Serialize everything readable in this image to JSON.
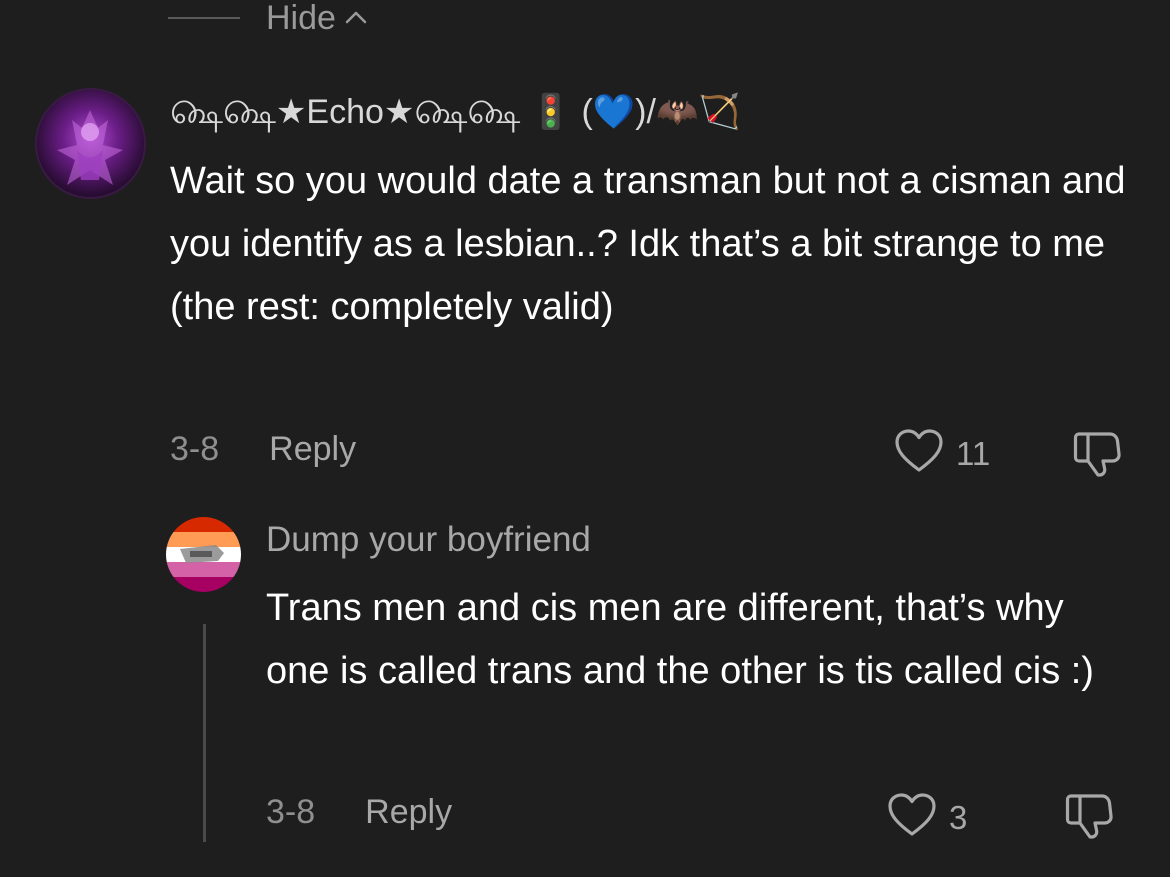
{
  "hide_toggle": {
    "label": "Hide"
  },
  "comments": [
    {
      "username": "௸௸★Echo★௸௸ 🚦 (💙)/🦇🏹",
      "text": "Wait so you would date a transman but not a cisman and you identify as a lesbian..? Idk that’s a bit strange to me (the rest: completely valid)",
      "date": "3-8",
      "reply_label": "Reply",
      "likes": "11"
    },
    {
      "username": "Dump your boyfriend",
      "text": "Trans men and cis men are different, that’s why one is called trans and the other is tis called cis :)",
      "date": "3-8",
      "reply_label": "Reply",
      "likes": "3"
    }
  ],
  "colors": {
    "background": "#1e1e1e",
    "secondary_text": "#a8a8a8",
    "lesbian_flag": [
      "#d62900",
      "#ff9b55",
      "#ffffff",
      "#d462a6",
      "#a50062"
    ]
  },
  "icons": [
    "chevron-up-icon",
    "heart-icon",
    "dislike-icon"
  ]
}
